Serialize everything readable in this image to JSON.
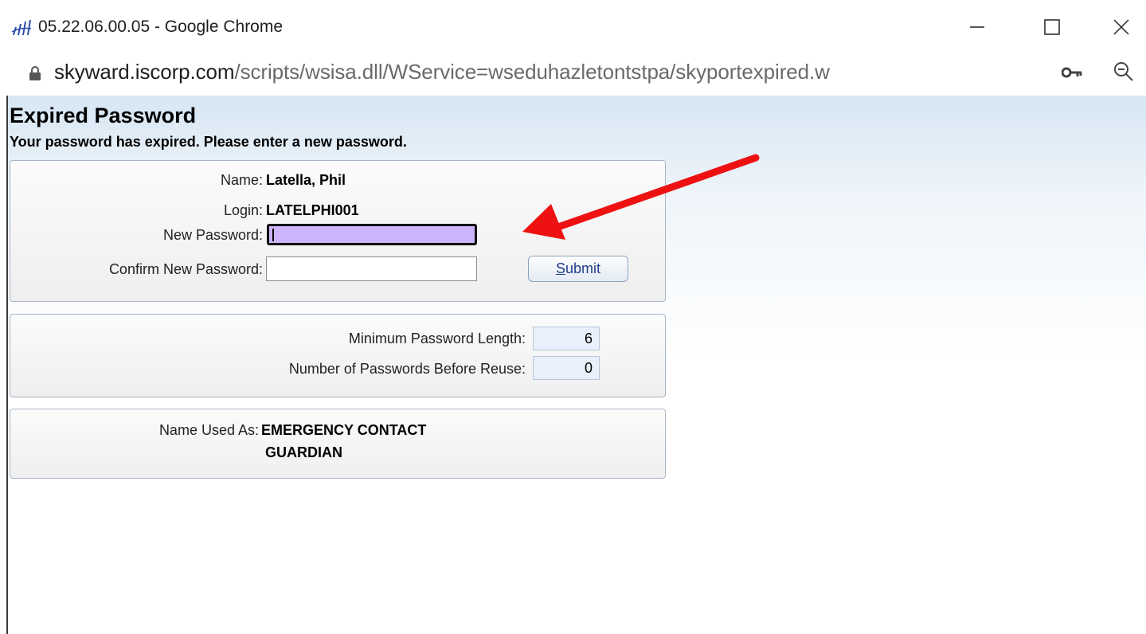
{
  "window": {
    "title": "05.22.06.00.05 - Google Chrome",
    "minimize_glyph": "—",
    "maximize_glyph": "☐",
    "close_glyph": "✕"
  },
  "address_bar": {
    "host": "skyward.iscorp.com",
    "path": "/scripts/wsisa.dll/WService=wseduhazletontstpa/skyportexpired.w"
  },
  "page": {
    "title": "Expired Password",
    "subtitle": "Your password has expired. Please enter a new password."
  },
  "account": {
    "name_label": "Name:",
    "name_value": "Latella, Phil",
    "login_label": "Login:",
    "login_value": "LATELPHI001",
    "new_password_label": "New Password:",
    "new_password_value": "",
    "confirm_password_label": "Confirm New Password:",
    "confirm_password_value": "",
    "submit_label_prefix": "S",
    "submit_label_rest": "ubmit"
  },
  "rules": {
    "min_length_label": "Minimum Password Length:",
    "min_length_value": "6",
    "reuse_label": "Number of Passwords Before Reuse:",
    "reuse_value": "0"
  },
  "usage": {
    "label": "Name Used As:",
    "roles": [
      "EMERGENCY CONTACT",
      "GUARDIAN"
    ]
  },
  "annotation": {
    "arrow_color": "#ee1111"
  },
  "colors": {
    "new_password_fill": "#cdb4fb",
    "panel_border": "#a7b5c4"
  }
}
